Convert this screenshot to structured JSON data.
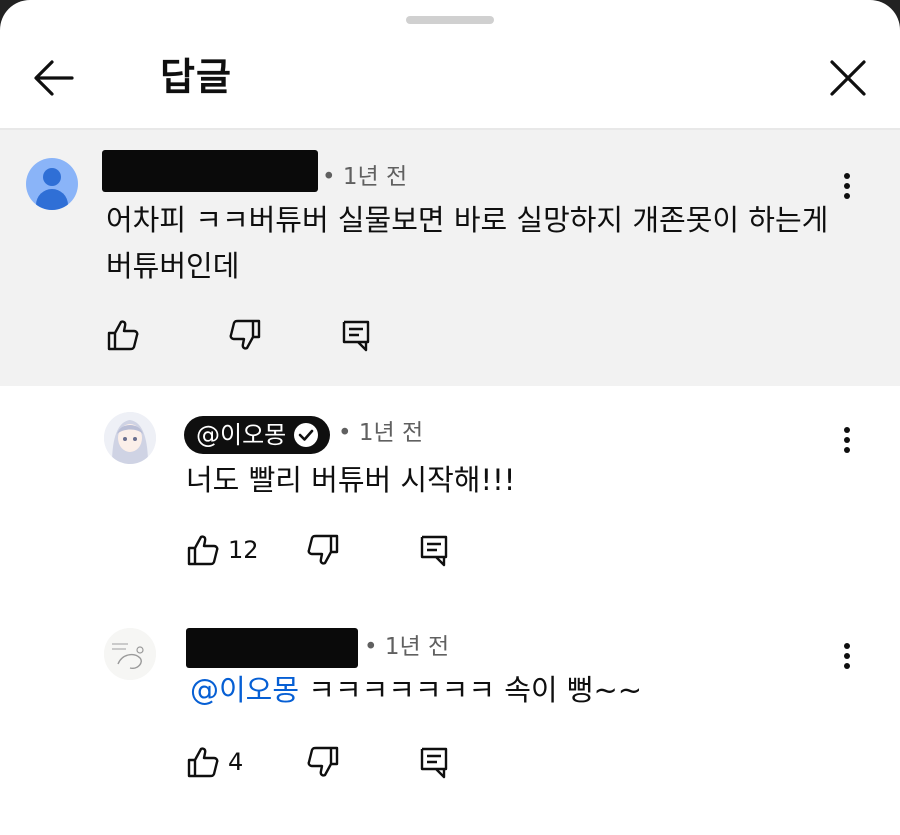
{
  "header": {
    "title": "답글"
  },
  "parent_comment": {
    "time": "• 1년 전",
    "text_line1": "어차피 ㅋㅋ버튜버 실물보면 바로 실망하지 개존못이 하는게",
    "text_line2": "버튜버인데"
  },
  "replies": [
    {
      "author": "@이오몽",
      "verified": true,
      "time": "• 1년 전",
      "text": "너도 빨리 버튜버 시작해!!!",
      "likes": "12"
    },
    {
      "time": "• 1년 전",
      "mention": "@이오몽",
      "text": " ㅋㅋㅋㅋㅋㅋㅋ 속이 뻥~~",
      "likes": "4"
    }
  ],
  "colors": {
    "mention": "#065fd4",
    "parent_bg": "#f2f2f2",
    "avatar_default": "#8ab4f8"
  },
  "icons": {
    "back": "arrow-left-icon",
    "close": "close-icon",
    "like": "thumbs-up-icon",
    "dislike": "thumbs-down-icon",
    "reply": "reply-icon",
    "more": "kebab-menu-icon"
  }
}
